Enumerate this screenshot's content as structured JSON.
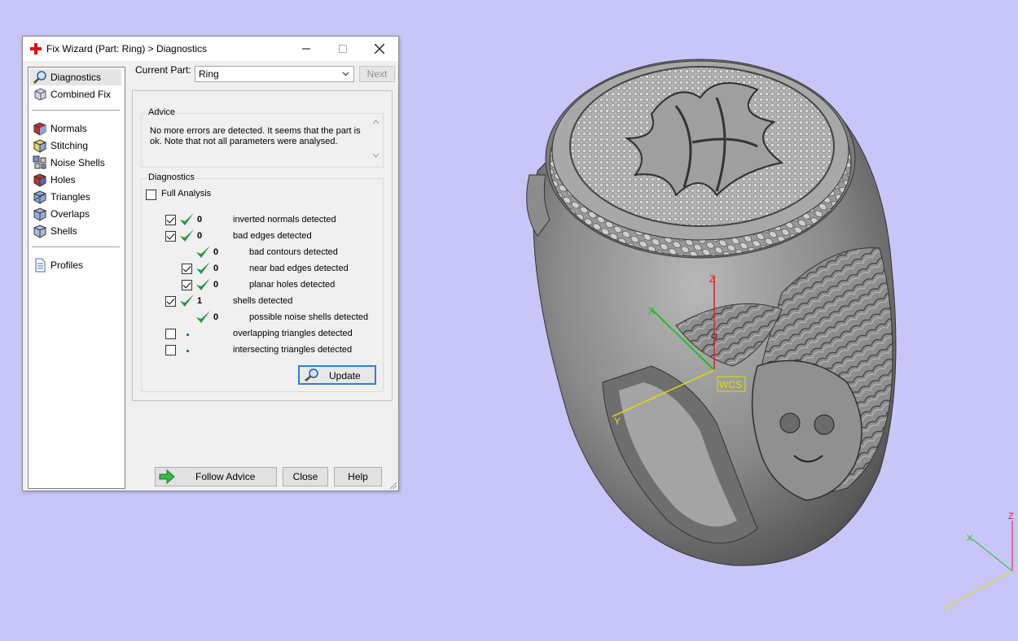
{
  "window": {
    "title": "Fix Wizard (Part: Ring) > Diagnostics"
  },
  "colors": {
    "background": "#c8c6f8",
    "accent": "#2f7fd8",
    "check": "#1f9a3a",
    "axis_x": "#21c021",
    "axis_y": "#e0e000",
    "axis_z": "#e02020"
  },
  "nav": {
    "items": [
      {
        "label": "Diagnostics",
        "icon": "magnifier-icon"
      },
      {
        "label": "Combined Fix",
        "icon": "combined-fix-icon"
      },
      {
        "label": "Normals",
        "icon": "normals-cube-icon"
      },
      {
        "label": "Stitching",
        "icon": "stitching-cube-icon"
      },
      {
        "label": "Noise Shells",
        "icon": "noise-shells-icon"
      },
      {
        "label": "Holes",
        "icon": "holes-cube-icon"
      },
      {
        "label": "Triangles",
        "icon": "triangles-cube-icon"
      },
      {
        "label": "Overlaps",
        "icon": "overlaps-cube-icon"
      },
      {
        "label": "Shells",
        "icon": "shells-cube-icon"
      },
      {
        "label": "Profiles",
        "icon": "profiles-document-icon"
      }
    ]
  },
  "part": {
    "label": "Current Part:",
    "value": "Ring",
    "next_label": "Next"
  },
  "advice": {
    "group_label": "Advice",
    "text": "No more errors are detected. It seems that the part is ok. Note that not all parameters were analysed."
  },
  "diagnostics": {
    "group_label": "Diagnostics",
    "full_analysis_label": "Full Analysis",
    "full_analysis_checked": false,
    "rows": [
      {
        "checked": true,
        "has_checkbox": true,
        "status": "ok",
        "count": "0",
        "label": "inverted normals detected"
      },
      {
        "checked": true,
        "has_checkbox": true,
        "status": "ok",
        "count": "0",
        "label": "bad edges detected"
      },
      {
        "checked": false,
        "has_checkbox": false,
        "status": "ok",
        "count": "0",
        "label": "bad contours detected"
      },
      {
        "checked": true,
        "has_checkbox": true,
        "status": "ok",
        "count": "0",
        "label": "near bad edges detected"
      },
      {
        "checked": true,
        "has_checkbox": true,
        "status": "ok",
        "count": "0",
        "label": "planar holes detected"
      },
      {
        "checked": true,
        "has_checkbox": true,
        "status": "ok",
        "count": "1",
        "label": "shells detected"
      },
      {
        "checked": false,
        "has_checkbox": false,
        "status": "ok",
        "count": "0",
        "label": "possible noise shells detected"
      },
      {
        "checked": false,
        "has_checkbox": true,
        "status": "pending",
        "count": "",
        "label": "overlapping triangles detected"
      },
      {
        "checked": false,
        "has_checkbox": true,
        "status": "pending",
        "count": "",
        "label": "intersecting triangles detected"
      }
    ],
    "update_label": "Update"
  },
  "buttons": {
    "follow_advice": "Follow Advice",
    "close": "Close",
    "help": "Help"
  },
  "viewport": {
    "axis_labels": {
      "x": "X",
      "y": "Y",
      "z": "Z"
    },
    "wcs_label": "WCS"
  }
}
